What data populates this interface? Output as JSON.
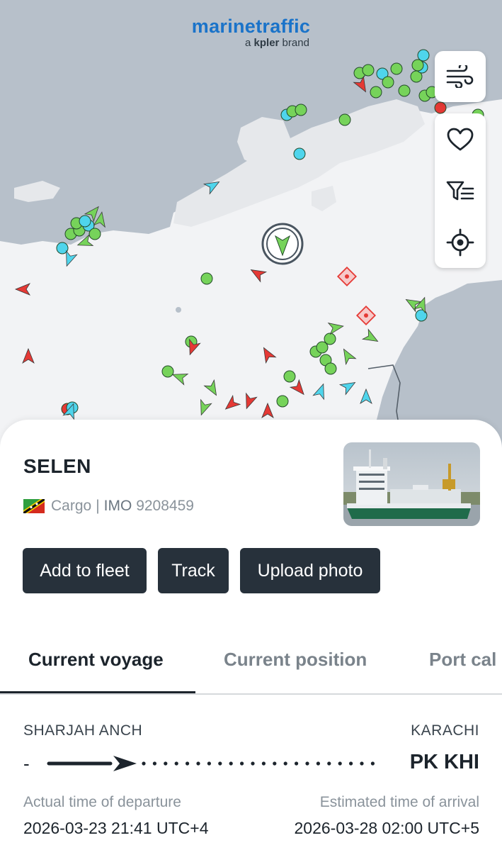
{
  "logo": {
    "name": "marinetraffic",
    "sub_prefix": "a",
    "sub_brand": "kpler",
    "sub_suffix": "brand"
  },
  "map_controls": {
    "weather": "wind-icon",
    "favourite": "heart-icon",
    "filter": "filter-list-icon",
    "locate": "crosshair-icon"
  },
  "vessel": {
    "name": "SELEN",
    "flag": "St Kitts and Nevis",
    "type": "Cargo",
    "separator": "|",
    "imo_label": "IMO",
    "imo": "9208459"
  },
  "actions": [
    {
      "label": "Add to fleet"
    },
    {
      "label": "Track"
    },
    {
      "label": "Upload photo"
    }
  ],
  "tabs": [
    {
      "label": "Current voyage",
      "active": true
    },
    {
      "label": "Current position",
      "active": false
    },
    {
      "label": "Port cal",
      "active": false
    }
  ],
  "voyage": {
    "origin_port": "SHARJAH ANCH",
    "origin_code": "-",
    "destination_port": "KARACHI",
    "destination_code": "PK KHI",
    "departure_label": "Actual time of departure",
    "departure_time": "2026-03-23 21:41 UTC+4",
    "arrival_label": "Estimated time of arrival",
    "arrival_time": "2026-03-28 02:00 UTC+5"
  },
  "colors": {
    "brand": "#1a73c9",
    "cargo": "#76d35a",
    "tanker": "#e53935",
    "passenger": "#4fd5ec",
    "button": "#27313b"
  }
}
